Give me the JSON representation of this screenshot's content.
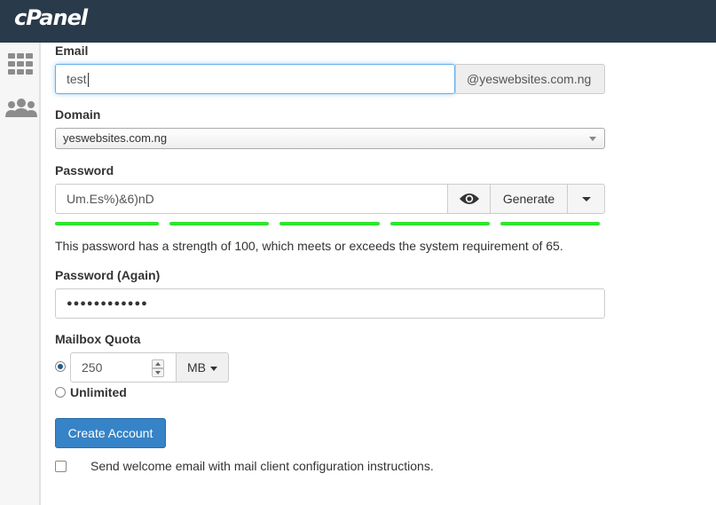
{
  "brand": {
    "logo_text": "cPanel"
  },
  "sidebar": {
    "icons": [
      "grid-icon",
      "users-icon"
    ]
  },
  "form": {
    "email": {
      "label": "Email",
      "value": "test",
      "domain_suffix": "@yeswebsites.com.ng"
    },
    "domain": {
      "label": "Domain",
      "selected": "yeswebsites.com.ng"
    },
    "password": {
      "label": "Password",
      "value": "Um.Es%)&6)nD",
      "generate_label": "Generate",
      "strength_segments": 5,
      "strength_color": "#2ee52e",
      "strength_message": "This password has a strength of 100, which meets or exceeds the system requirement of 65."
    },
    "password_again": {
      "label": "Password (Again)",
      "masked_value": "●●●●●●●●●●●●"
    },
    "quota": {
      "label": "Mailbox Quota",
      "value": "250",
      "unit": "MB",
      "unlimited_label": "Unlimited",
      "selected_option": "value"
    },
    "submit_label": "Create Account",
    "welcome_email": {
      "label": "Send welcome email with mail client configuration instructions.",
      "checked": false
    }
  },
  "colors": {
    "header": "#293a4a",
    "primary": "#3683c7",
    "focus": "#66afe9"
  }
}
